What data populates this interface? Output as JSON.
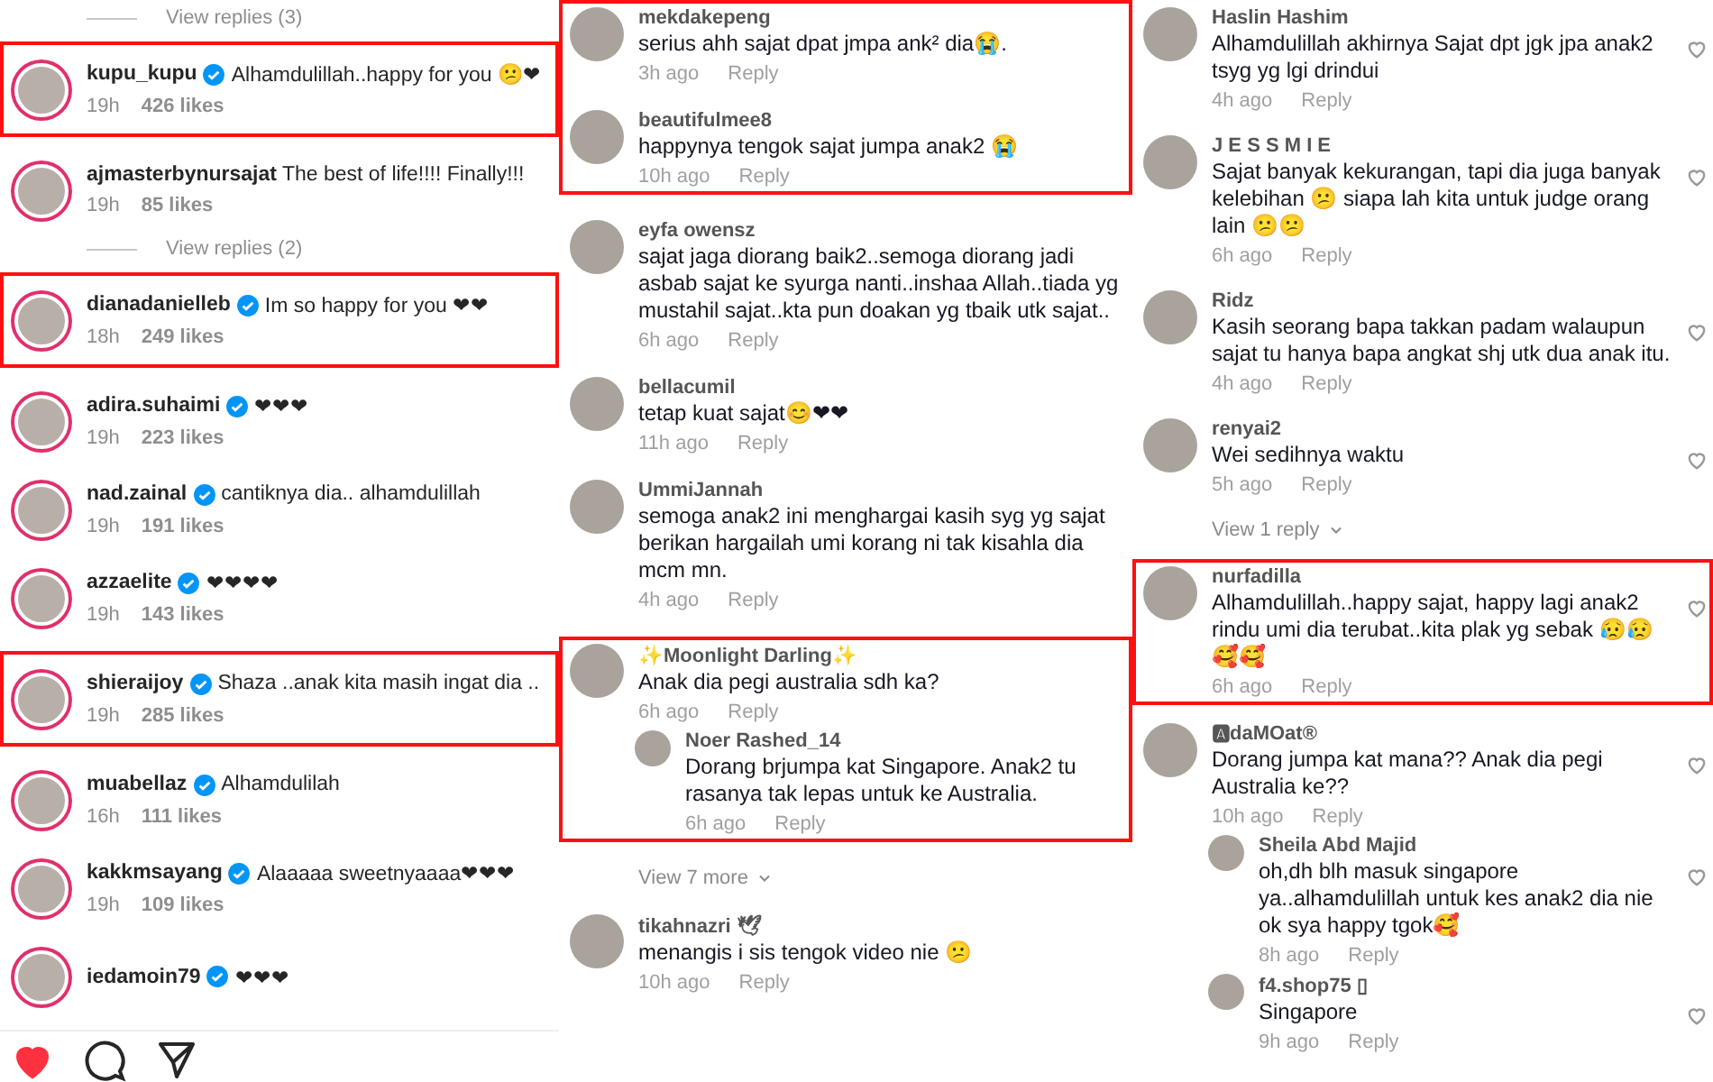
{
  "left_panel": {
    "blocks": [
      {
        "highlighted": false,
        "items": [
          {
            "kind": "more_link",
            "label": "View replies (3)"
          }
        ]
      },
      {
        "highlighted": true,
        "items": [
          {
            "kind": "comment",
            "username": "kupu_kupu",
            "verified": true,
            "text": "Alhamdulillah..happy for you 😕❤",
            "time": "19h",
            "likes": "426 likes"
          }
        ]
      },
      {
        "highlighted": false,
        "items": [
          {
            "kind": "comment",
            "username": "ajmasterbynursajat",
            "verified": false,
            "text": "The best of life!!!! Finally!!!",
            "time": "19h",
            "likes": "85 likes"
          },
          {
            "kind": "more_link",
            "label": "View replies (2)"
          }
        ]
      },
      {
        "highlighted": true,
        "items": [
          {
            "kind": "comment",
            "username": "dianadanielleb",
            "verified": true,
            "text": "Im so happy for you ❤❤",
            "time": "18h",
            "likes": "249 likes"
          }
        ]
      },
      {
        "highlighted": false,
        "items": [
          {
            "kind": "comment",
            "username": "adira.suhaimi",
            "verified": true,
            "text": "❤❤❤",
            "time": "19h",
            "likes": "223 likes"
          },
          {
            "kind": "comment",
            "username": "nad.zainal",
            "verified": true,
            "text": "cantiknya dia.. alhamdulillah",
            "time": "19h",
            "likes": "191 likes"
          },
          {
            "kind": "comment",
            "username": "azzaelite",
            "verified": true,
            "text": "❤❤❤❤",
            "time": "19h",
            "likes": "143 likes"
          }
        ]
      },
      {
        "highlighted": true,
        "items": [
          {
            "kind": "comment",
            "username": "shieraijoy",
            "verified": true,
            "text": "Shaza ..anak kita masih ingat dia ..",
            "time": "19h",
            "likes": "285 likes"
          }
        ]
      },
      {
        "highlighted": false,
        "items": [
          {
            "kind": "comment",
            "username": "muabellaz",
            "verified": true,
            "text": "Alhamdulilah",
            "time": "16h",
            "likes": "111 likes"
          },
          {
            "kind": "comment",
            "username": "kakkmsayang",
            "verified": true,
            "text": "Alaaaaa sweetnyaaaa❤❤❤",
            "time": "19h",
            "likes": "109 likes"
          },
          {
            "kind": "comment",
            "username": "iedamoin79",
            "verified": true,
            "text": "❤❤❤"
          }
        ]
      }
    ],
    "actions": {
      "liked": true
    }
  },
  "middle_panel": {
    "blocks": [
      {
        "highlighted": true,
        "items": [
          {
            "kind": "comment",
            "username": "mekdakepeng",
            "text": "serius ahh sajat dpat jmpa ank² dia😭.",
            "time": "3h ago",
            "reply": "Reply"
          },
          {
            "kind": "comment",
            "username": "beautifulmee8",
            "text": "happynya tengok sajat jumpa anak2 😭",
            "time": "10h ago",
            "reply": "Reply"
          }
        ]
      },
      {
        "highlighted": false,
        "items": [
          {
            "kind": "comment",
            "username": "eyfa owensz",
            "text": "sajat jaga diorang baik2..semoga diorang jadi asbab sajat ke syurga nanti..inshaa Allah..tiada yg mustahil sajat..kta pun doakan yg tbaik utk sajat..",
            "time": "6h ago",
            "reply": "Reply"
          },
          {
            "kind": "comment",
            "username": "bellacumil",
            "text": "tetap kuat sajat😊❤❤",
            "time": "11h ago",
            "reply": "Reply"
          },
          {
            "kind": "comment",
            "username": "UmmiJannah",
            "text": "semoga anak2 ini menghargai kasih syg yg sajat berikan hargailah umi korang ni tak kisahla dia mcm mn.",
            "time": "4h ago",
            "reply": "Reply"
          }
        ]
      },
      {
        "highlighted": true,
        "items": [
          {
            "kind": "comment",
            "username": "✨Moonlight Darling✨",
            "text": "Anak dia pegi australia sdh ka?",
            "time": "6h ago",
            "reply": "Reply",
            "replies": [
              {
                "kind": "comment",
                "username": "Noer Rashed_14",
                "text": "Dorang brjumpa kat Singapore. Anak2 tu rasanya tak lepas untuk ke Australia.",
                "time": "6h ago",
                "reply": "Reply"
              }
            ]
          }
        ]
      },
      {
        "highlighted": false,
        "items": [
          {
            "kind": "more_link",
            "label": "View 7 more"
          },
          {
            "kind": "comment",
            "username": "tikahnazri 🕊",
            "text": "menangis i sis tengok video nie 😕",
            "time": "10h ago",
            "reply": "Reply"
          }
        ]
      }
    ]
  },
  "right_panel": {
    "blocks": [
      {
        "highlighted": false,
        "items": [
          {
            "kind": "comment",
            "username": "Haslin Hashim",
            "text": "Alhamdulillah akhirnya Sajat dpt jgk jpa anak2 tsyg yg lgi drindui",
            "time": "4h ago",
            "reply": "Reply"
          },
          {
            "kind": "comment",
            "username": "J E S S M I E",
            "text": "Sajat banyak kekurangan, tapi dia juga banyak kelebihan 😕 siapa lah kita untuk judge orang lain 😕😕",
            "time": "6h ago",
            "reply": "Reply"
          },
          {
            "kind": "comment",
            "username": "Ridz",
            "text": "Kasih seorang bapa takkan padam walaupun sajat tu hanya bapa angkat shj utk dua anak itu.",
            "time": "4h ago",
            "reply": "Reply"
          },
          {
            "kind": "comment",
            "username": "renyai2",
            "text": "Wei sedihnya waktu",
            "time": "5h ago",
            "reply": "Reply"
          },
          {
            "kind": "more_link",
            "label": "View 1 reply"
          }
        ]
      },
      {
        "highlighted": true,
        "items": [
          {
            "kind": "comment",
            "username": "nurfadilla",
            "text": "Alhamdulillah..happy sajat, happy lagi anak2 rindu umi dia terubat..kita plak yg sebak 😥😥🥰🥰",
            "time": "6h ago",
            "reply": "Reply"
          }
        ]
      },
      {
        "highlighted": false,
        "items": [
          {
            "kind": "comment",
            "username": "🅰daMOat®",
            "text": "Dorang jumpa kat mana?? Anak dia pegi Australia ke??",
            "time": "10h ago",
            "reply": "Reply",
            "replies": [
              {
                "kind": "comment",
                "username": "Sheila Abd Majid",
                "text": "oh,dh blh masuk singapore ya..alhamdulillah untuk kes anak2 dia nie ok sya happy tgok🥰",
                "time": "8h ago",
                "reply": "Reply"
              },
              {
                "kind": "comment",
                "username": "f4.shop75 ▯",
                "text": "Singapore",
                "time": "9h ago",
                "reply": "Reply"
              }
            ]
          }
        ]
      }
    ]
  }
}
